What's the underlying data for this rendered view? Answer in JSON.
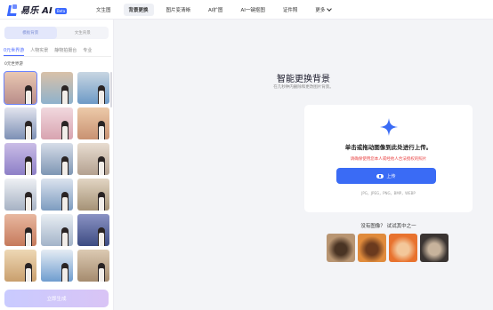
{
  "header": {
    "logo_text": "易乐 AI",
    "logo_badge": "Beta",
    "nav": [
      {
        "label": "文生图",
        "active": false
      },
      {
        "label": "背景更换",
        "active": true
      },
      {
        "label": "图片变清晰",
        "active": false
      },
      {
        "label": "AI扩图",
        "active": false
      },
      {
        "label": "AI一键抠图",
        "active": false
      },
      {
        "label": "证件照",
        "active": false
      }
    ],
    "more_label": "更多"
  },
  "sidebar": {
    "mode_tabs": [
      {
        "label": "模板背景",
        "active": true
      },
      {
        "label": "文生背景",
        "active": false
      }
    ],
    "category_tabs": [
      {
        "label": "0元世界游",
        "active": true
      },
      {
        "label": "人物实景",
        "active": false
      },
      {
        "label": "静物拍摄台",
        "active": false
      },
      {
        "label": "专业",
        "active": false
      }
    ],
    "section_title": "0元世界游",
    "thumbnails": [
      {
        "name": "thumb-sunset-balcony",
        "colors": [
          "#b98d8a",
          "#e9c8b2"
        ],
        "selected": true
      },
      {
        "name": "thumb-balloons",
        "colors": [
          "#8fb2cc",
          "#d8c1a8"
        ],
        "selected": false
      },
      {
        "name": "thumb-christ-statue",
        "colors": [
          "#6d9ac6",
          "#c8d6e2"
        ],
        "selected": false
      },
      {
        "name": "thumb-mount-fuji",
        "colors": [
          "#7d90b5",
          "#e2e4ee"
        ],
        "selected": false
      },
      {
        "name": "thumb-cherry-blossom",
        "colors": [
          "#d8a4b0",
          "#f1d8de"
        ],
        "selected": false
      },
      {
        "name": "thumb-desert-sunset",
        "colors": [
          "#c99272",
          "#eccaa9"
        ],
        "selected": false
      },
      {
        "name": "thumb-lavender",
        "colors": [
          "#8d7fc7",
          "#cabde6"
        ],
        "selected": false
      },
      {
        "name": "thumb-city-skyline",
        "colors": [
          "#7e96b4",
          "#d6dde8"
        ],
        "selected": false
      },
      {
        "name": "thumb-eiffel-tower",
        "colors": [
          "#b4a190",
          "#e8ddd1"
        ],
        "selected": false
      },
      {
        "name": "thumb-snow-village",
        "colors": [
          "#a6b2c4",
          "#eef0f4"
        ],
        "selected": false
      },
      {
        "name": "thumb-burj-khalifa",
        "colors": [
          "#7d9cc0",
          "#dbe3ee"
        ],
        "selected": false
      },
      {
        "name": "thumb-venice",
        "colors": [
          "#a59276",
          "#e2d5c3"
        ],
        "selected": false
      },
      {
        "name": "thumb-golden-gate",
        "colors": [
          "#c67a5c",
          "#e8b8a0"
        ],
        "selected": false
      },
      {
        "name": "thumb-taj-mahal",
        "colors": [
          "#a3b4c9",
          "#e9eef3"
        ],
        "selected": false
      },
      {
        "name": "thumb-night-city",
        "colors": [
          "#3d4c82",
          "#8a92c4"
        ],
        "selected": false
      },
      {
        "name": "thumb-pyramids",
        "colors": [
          "#c99f6d",
          "#eed8b5"
        ],
        "selected": false
      },
      {
        "name": "thumb-santorini",
        "colors": [
          "#6f9dcf",
          "#e5ecf4"
        ],
        "selected": false
      },
      {
        "name": "thumb-colosseum",
        "colors": [
          "#a58b6e",
          "#dccab3"
        ],
        "selected": false
      }
    ],
    "generate_button": "立即生成"
  },
  "main": {
    "title": "智能更换背景",
    "subtitle": "在几秒钟内删除和更改图片背景。",
    "upload": {
      "title": "单击或拖动图像到此处进行上传。",
      "warning": "请确保使用您本人或经他人合法授权的照片",
      "button_label": "上传",
      "formats": "JPG，JPEG，PNG，BMP，WEBP"
    },
    "samples_title": "没有图像？ 试试其中之一",
    "samples": [
      {
        "name": "sample-perfume",
        "colors": [
          "#b89572",
          "#4a3424"
        ]
      },
      {
        "name": "sample-woman-orange",
        "colors": [
          "#e08b3c",
          "#6b3a1e"
        ]
      },
      {
        "name": "sample-dog",
        "colors": [
          "#e8722e",
          "#f3c79a"
        ]
      },
      {
        "name": "sample-woman-dark",
        "colors": [
          "#3a3432",
          "#c7b39c"
        ]
      }
    ]
  },
  "colors": {
    "accent": "#3a6bf5",
    "warning": "#e84040",
    "selected_tab": "#4d6bff"
  }
}
